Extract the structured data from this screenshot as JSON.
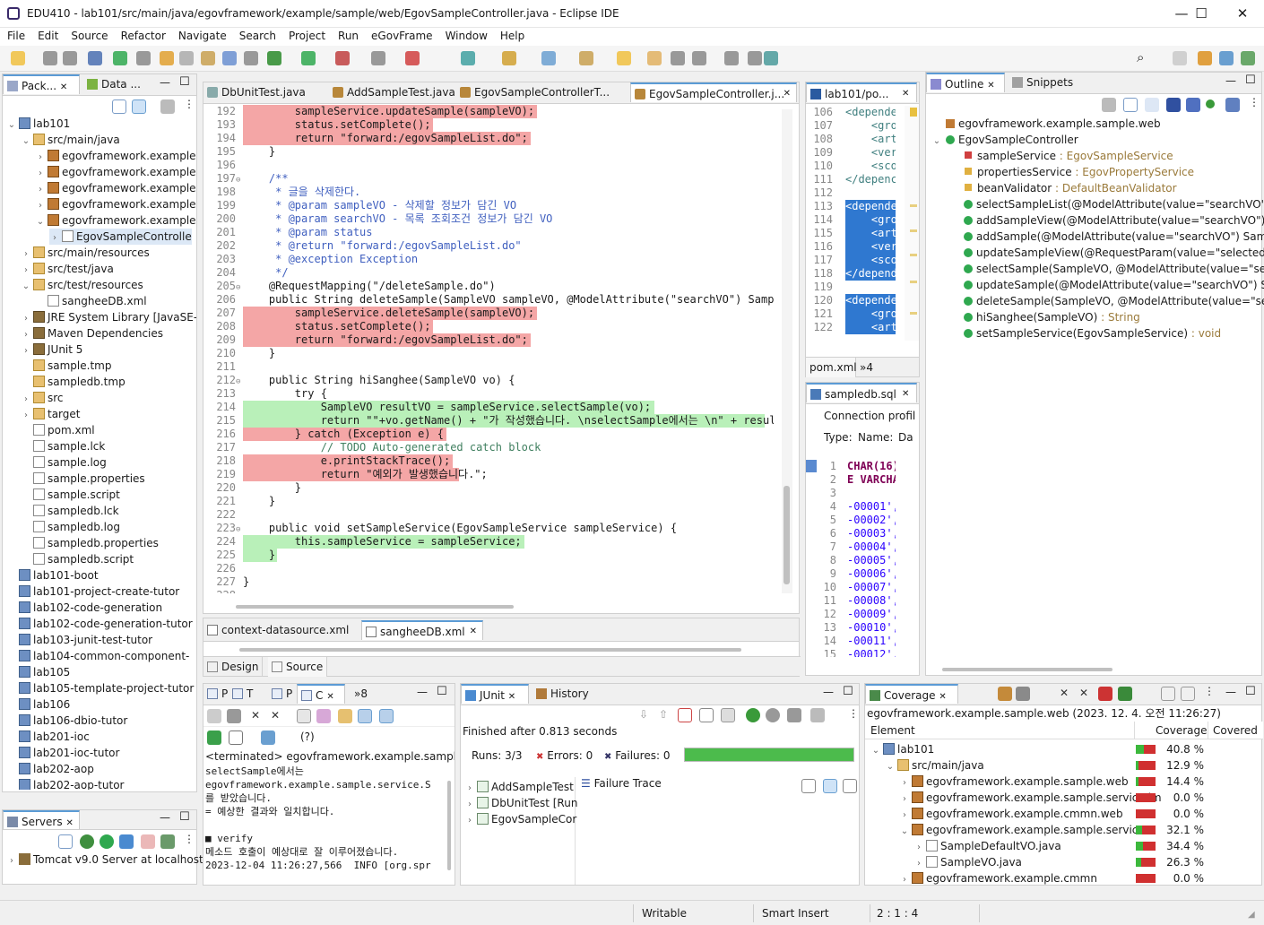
{
  "window": {
    "title": "EDU410 - lab101/src/main/java/egovframework/example/sample/web/EgovSampleController.java - Eclipse IDE",
    "minimize": "—",
    "maximize": "☐",
    "close": "✕"
  },
  "menu": [
    "File",
    "Edit",
    "Source",
    "Refactor",
    "Navigate",
    "Search",
    "Project",
    "Run",
    "eGovFrame",
    "Window",
    "Help"
  ],
  "left_tabs": {
    "pkg": "Pack...",
    "data": "Data ..."
  },
  "project_tree": [
    {
      "d": 0,
      "t": "lab101",
      "i": "prj",
      "e": "v"
    },
    {
      "d": 1,
      "t": "src/main/java",
      "i": "fld",
      "e": "v"
    },
    {
      "d": 2,
      "t": "egovframework.example",
      "i": "pkg",
      "e": ">"
    },
    {
      "d": 2,
      "t": "egovframework.example",
      "i": "pkg",
      "e": ">"
    },
    {
      "d": 2,
      "t": "egovframework.example",
      "i": "pkg",
      "e": ">"
    },
    {
      "d": 2,
      "t": "egovframework.example",
      "i": "pkg",
      "e": ">"
    },
    {
      "d": 2,
      "t": "egovframework.example",
      "i": "pkg",
      "e": "v"
    },
    {
      "d": 3,
      "t": "EgovSampleControlle",
      "i": "file",
      "e": ">",
      "sel": true
    },
    {
      "d": 1,
      "t": "src/main/resources",
      "i": "fld",
      "e": ">"
    },
    {
      "d": 1,
      "t": "src/test/java",
      "i": "fld",
      "e": ">"
    },
    {
      "d": 1,
      "t": "src/test/resources",
      "i": "fld",
      "e": "v"
    },
    {
      "d": 2,
      "t": "sangheeDB.xml",
      "i": "file",
      "e": ""
    },
    {
      "d": 1,
      "t": "JRE System Library [JavaSE-",
      "i": "jar",
      "e": ">"
    },
    {
      "d": 1,
      "t": "Maven Dependencies",
      "i": "jar",
      "e": ">"
    },
    {
      "d": 1,
      "t": "JUnit 5",
      "i": "jar",
      "e": ">"
    },
    {
      "d": 1,
      "t": "sample.tmp",
      "i": "fld",
      "e": ""
    },
    {
      "d": 1,
      "t": "sampledb.tmp",
      "i": "fld",
      "e": ""
    },
    {
      "d": 1,
      "t": "src",
      "i": "fld",
      "e": ">"
    },
    {
      "d": 1,
      "t": "target",
      "i": "fld",
      "e": ">"
    },
    {
      "d": 1,
      "t": "pom.xml",
      "i": "file",
      "e": ""
    },
    {
      "d": 1,
      "t": "sample.lck",
      "i": "file",
      "e": ""
    },
    {
      "d": 1,
      "t": "sample.log",
      "i": "file",
      "e": ""
    },
    {
      "d": 1,
      "t": "sample.properties",
      "i": "file",
      "e": ""
    },
    {
      "d": 1,
      "t": "sample.script",
      "i": "file",
      "e": ""
    },
    {
      "d": 1,
      "t": "sampledb.lck",
      "i": "file",
      "e": ""
    },
    {
      "d": 1,
      "t": "sampledb.log",
      "i": "file",
      "e": ""
    },
    {
      "d": 1,
      "t": "sampledb.properties",
      "i": "file",
      "e": ""
    },
    {
      "d": 1,
      "t": "sampledb.script",
      "i": "file",
      "e": ""
    },
    {
      "d": 0,
      "t": "lab101-boot",
      "i": "prj",
      "e": ""
    },
    {
      "d": 0,
      "t": "lab101-project-create-tutor",
      "i": "prj",
      "e": ""
    },
    {
      "d": 0,
      "t": "lab102-code-generation",
      "i": "prj",
      "e": ""
    },
    {
      "d": 0,
      "t": "lab102-code-generation-tutor",
      "i": "prj",
      "e": ""
    },
    {
      "d": 0,
      "t": "lab103-junit-test-tutor",
      "i": "prj",
      "e": ""
    },
    {
      "d": 0,
      "t": "lab104-common-component-",
      "i": "prj",
      "e": ""
    },
    {
      "d": 0,
      "t": "lab105",
      "i": "prj",
      "e": ""
    },
    {
      "d": 0,
      "t": "lab105-template-project-tutor",
      "i": "prj",
      "e": ""
    },
    {
      "d": 0,
      "t": "lab106",
      "i": "prj",
      "e": ""
    },
    {
      "d": 0,
      "t": "lab106-dbio-tutor",
      "i": "prj",
      "e": ""
    },
    {
      "d": 0,
      "t": "lab201-ioc",
      "i": "prj",
      "e": ""
    },
    {
      "d": 0,
      "t": "lab201-ioc-tutor",
      "i": "prj",
      "e": ""
    },
    {
      "d": 0,
      "t": "lab202-aop",
      "i": "prj",
      "e": ""
    },
    {
      "d": 0,
      "t": "lab202-aop-tutor",
      "i": "prj",
      "e": ""
    }
  ],
  "servers": {
    "tab": "Servers",
    "item": "Tomcat v9.0 Server at localhost"
  },
  "editor_tabs": [
    "DbUnitTest.java",
    "AddSampleTest.java",
    "EgovSampleControllerT...",
    "EgovSampleController.j..."
  ],
  "code": [
    {
      "n": "192",
      "h": "red",
      "t": "        sampleService.updateSample(sampleVO);"
    },
    {
      "n": "193",
      "h": "red",
      "t": "        status.setComplete();"
    },
    {
      "n": "194",
      "h": "red",
      "t": "        return \"forward:/egovSampleList.do\";"
    },
    {
      "n": "195",
      "h": "",
      "t": "    }"
    },
    {
      "n": "196",
      "h": "",
      "t": ""
    },
    {
      "n": "197",
      "h": "",
      "t": "    /**"
    },
    {
      "n": "198",
      "h": "",
      "t": "     * 글을 삭제한다."
    },
    {
      "n": "199",
      "h": "",
      "t": "     * @param sampleVO - 삭제할 정보가 담긴 VO"
    },
    {
      "n": "200",
      "h": "",
      "t": "     * @param searchVO - 목록 조회조건 정보가 담긴 VO"
    },
    {
      "n": "201",
      "h": "",
      "t": "     * @param status"
    },
    {
      "n": "202",
      "h": "",
      "t": "     * @return \"forward:/egovSampleList.do\""
    },
    {
      "n": "203",
      "h": "",
      "t": "     * @exception Exception"
    },
    {
      "n": "204",
      "h": "",
      "t": "     */"
    },
    {
      "n": "205",
      "h": "",
      "t": "    @RequestMapping(\"/deleteSample.do\")"
    },
    {
      "n": "206",
      "h": "",
      "t": "    public String deleteSample(SampleVO sampleVO, @ModelAttribute(\"searchVO\") SampleD"
    },
    {
      "n": "207",
      "h": "red",
      "t": "        sampleService.deleteSample(sampleVO);"
    },
    {
      "n": "208",
      "h": "red",
      "t": "        status.setComplete();"
    },
    {
      "n": "209",
      "h": "red",
      "t": "        return \"forward:/egovSampleList.do\";"
    },
    {
      "n": "210",
      "h": "",
      "t": "    }"
    },
    {
      "n": "211",
      "h": "",
      "t": ""
    },
    {
      "n": "212",
      "h": "",
      "t": "    public String hiSanghee(SampleVO vo) {"
    },
    {
      "n": "213",
      "h": "",
      "t": "        try {"
    },
    {
      "n": "214",
      "h": "grn",
      "t": "            SampleVO resultVO = sampleService.selectSample(vo);"
    },
    {
      "n": "215",
      "h": "grn",
      "t": "            return \"\"+vo.getName() + \"가 작성했습니다. \\nselectSample에서는 \\n\" + resultVO"
    },
    {
      "n": "216",
      "h": "red",
      "t": "        } catch (Exception e) {"
    },
    {
      "n": "217",
      "h": "",
      "t": "            // TODO Auto-generated catch block"
    },
    {
      "n": "218",
      "h": "red",
      "t": "            e.printStackTrace();"
    },
    {
      "n": "219",
      "h": "red",
      "t": "            return \"예외가 발생했습니다.\";"
    },
    {
      "n": "220",
      "h": "",
      "t": "        }"
    },
    {
      "n": "221",
      "h": "",
      "t": "    }"
    },
    {
      "n": "222",
      "h": "",
      "t": ""
    },
    {
      "n": "223",
      "h": "",
      "t": "    public void setSampleService(EgovSampleService sampleService) {"
    },
    {
      "n": "224",
      "h": "grn",
      "t": "        this.sampleService = sampleService;"
    },
    {
      "n": "225",
      "h": "grn",
      "t": "    }"
    },
    {
      "n": "226",
      "h": "",
      "t": ""
    },
    {
      "n": "227",
      "h": "",
      "t": "}"
    },
    {
      "n": "228",
      "h": "",
      "t": ""
    }
  ],
  "xml_tabs": [
    "context-datasource.xml",
    "sangheeDB.xml"
  ],
  "design_tabs": [
    "Design",
    "Source"
  ],
  "pom": {
    "tab": "lab101/po...",
    "bottom_tabs": [
      "pom.xml",
      "»4"
    ],
    "lines": [
      {
        "n": "106",
        "t": "<depende",
        "s": false
      },
      {
        "n": "107",
        "t": "    <gro",
        "s": false
      },
      {
        "n": "108",
        "t": "    <art",
        "s": false
      },
      {
        "n": "109",
        "t": "    <ver",
        "s": false
      },
      {
        "n": "110",
        "t": "    <sco",
        "s": false
      },
      {
        "n": "111",
        "t": "</depenc",
        "s": false
      },
      {
        "n": "112",
        "t": "",
        "s": false
      },
      {
        "n": "113",
        "t": "<depende",
        "s": true
      },
      {
        "n": "114",
        "t": "    <gro",
        "s": true
      },
      {
        "n": "115",
        "t": "    <art",
        "s": true
      },
      {
        "n": "116",
        "t": "    <ver",
        "s": true
      },
      {
        "n": "117",
        "t": "    <sco",
        "s": true
      },
      {
        "n": "118",
        "t": "</depend",
        "s": true
      },
      {
        "n": "119",
        "t": "",
        "s": true
      },
      {
        "n": "120",
        "t": "<depende",
        "s": true
      },
      {
        "n": "121",
        "t": "    <gro",
        "s": true
      },
      {
        "n": "122",
        "t": "    <art",
        "s": true
      }
    ]
  },
  "sql": {
    "tab": "sampledb.sql",
    "conn": "Connection profil",
    "type": "Type:",
    "name": "Name:",
    "da": "Da",
    "lines": [
      {
        "n": "1",
        "t": "CHAR(16)"
      },
      {
        "n": "2",
        "t": "E VARCHA"
      },
      {
        "n": "3",
        "t": ""
      },
      {
        "n": "4",
        "t": "-00001',"
      },
      {
        "n": "5",
        "t": "-00002',"
      },
      {
        "n": "6",
        "t": "-00003',"
      },
      {
        "n": "7",
        "t": "-00004',"
      },
      {
        "n": "8",
        "t": "-00005',"
      },
      {
        "n": "9",
        "t": "-00006',"
      },
      {
        "n": "10",
        "t": "-00007',"
      },
      {
        "n": "11",
        "t": "-00008',"
      },
      {
        "n": "12",
        "t": "-00009',"
      },
      {
        "n": "13",
        "t": "-00010',"
      },
      {
        "n": "14",
        "t": "-00011',"
      },
      {
        "n": "15",
        "t": "-00012',"
      }
    ]
  },
  "outline": {
    "tabs": [
      "Outline",
      "Snippets"
    ],
    "items": [
      {
        "d": 0,
        "t": "egovframework.example.sample.web",
        "r": "",
        "k": "pkg"
      },
      {
        "d": 0,
        "t": "EgovSampleController",
        "r": "",
        "k": "class"
      },
      {
        "d": 1,
        "t": "sampleService",
        "r": " : EgovSampleService",
        "k": "priv"
      },
      {
        "d": 1,
        "t": "propertiesService",
        "r": " : EgovPropertyService",
        "k": "prot"
      },
      {
        "d": 1,
        "t": "beanValidator",
        "r": " : DefaultBeanValidator",
        "k": "prot"
      },
      {
        "d": 1,
        "t": "selectSampleList(@ModelAttribute(value=\"searchVO\") Sa",
        "r": "",
        "k": "pub"
      },
      {
        "d": 1,
        "t": "addSampleView(@ModelAttribute(value=\"searchVO\") Sa",
        "r": "",
        "k": "pub"
      },
      {
        "d": 1,
        "t": "addSample(@ModelAttribute(value=\"searchVO\") Sample",
        "r": "",
        "k": "pub"
      },
      {
        "d": 1,
        "t": "updateSampleView(@RequestParam(value=\"selectedId\")",
        "r": "",
        "k": "pub"
      },
      {
        "d": 1,
        "t": "selectSample(SampleVO, @ModelAttribute(value=\"search",
        "r": "",
        "k": "pub"
      },
      {
        "d": 1,
        "t": "updateSample(@ModelAttribute(value=\"searchVO\") Sam",
        "r": "",
        "k": "pub"
      },
      {
        "d": 1,
        "t": "deleteSample(SampleVO, @ModelAttribute(value=\"searcl",
        "r": "",
        "k": "pub"
      },
      {
        "d": 1,
        "t": "hiSanghee(SampleVO)",
        "r": " : String",
        "k": "pub"
      },
      {
        "d": 1,
        "t": "setSampleService(EgovSampleService)",
        "r": " : void",
        "k": "pub"
      }
    ]
  },
  "console": {
    "tabs": [
      "P",
      "T",
      "P",
      "C",
      "»8"
    ],
    "help": "(?)",
    "header": "<terminated> egovframework.example.sample.web [",
    "lines": [
      "selectSample에서는",
      "egovframework.example.sample.service.S",
      "를 받았습니다.",
      "= 예상한 결과와 일치합니다.",
      "",
      "■ verify",
      "메소드 호출이 예상대로 잘 이루어졌습니다.",
      "2023-12-04 11:26:27,566  INFO [org.spr"
    ]
  },
  "junit": {
    "tabs": [
      "JUnit",
      "History"
    ],
    "finished": "Finished after 0.813 seconds",
    "runs_label": "Runs:",
    "runs": "3/3",
    "errors_label": "Errors:",
    "errors": "0",
    "failures_label": "Failures:",
    "failures": "0",
    "progress": 1.0,
    "tests": [
      "AddSampleTest",
      "DbUnitTest [Run",
      "EgovSampleCor"
    ],
    "trace": "Failure Trace"
  },
  "coverage": {
    "tab": "Coverage",
    "session": "egovframework.example.sample.web (2023. 12. 4. 오전 11:26:27)",
    "cols": [
      "Element",
      "Coverage",
      "Covered"
    ],
    "rows": [
      {
        "d": 0,
        "t": "lab101",
        "c": "40.8 %",
        "v": 0.408,
        "e": "v",
        "k": "prj"
      },
      {
        "d": 1,
        "t": "src/main/java",
        "c": "12.9 %",
        "v": 0.129,
        "e": "v",
        "k": "fld"
      },
      {
        "d": 2,
        "t": "egovframework.example.sample.web",
        "c": "14.4 %",
        "v": 0.144,
        "e": ">",
        "k": "pkg"
      },
      {
        "d": 2,
        "t": "egovframework.example.sample.service.im",
        "c": "0.0 %",
        "v": 0.0,
        "e": ">",
        "k": "pkg"
      },
      {
        "d": 2,
        "t": "egovframework.example.cmmn.web",
        "c": "0.0 %",
        "v": 0.0,
        "e": ">",
        "k": "pkg"
      },
      {
        "d": 2,
        "t": "egovframework.example.sample.service",
        "c": "32.1 %",
        "v": 0.321,
        "e": "v",
        "k": "pkg"
      },
      {
        "d": 3,
        "t": "SampleDefaultVO.java",
        "c": "34.4 %",
        "v": 0.344,
        "e": ">",
        "k": "file"
      },
      {
        "d": 3,
        "t": "SampleVO.java",
        "c": "26.3 %",
        "v": 0.263,
        "e": ">",
        "k": "file"
      },
      {
        "d": 2,
        "t": "egovframework.example.cmmn",
        "c": "0.0 %",
        "v": 0.0,
        "e": ">",
        "k": "pkg"
      }
    ]
  },
  "statusbar": {
    "writable": "Writable",
    "insert": "Smart Insert",
    "pos": "2 : 1 : 4"
  }
}
